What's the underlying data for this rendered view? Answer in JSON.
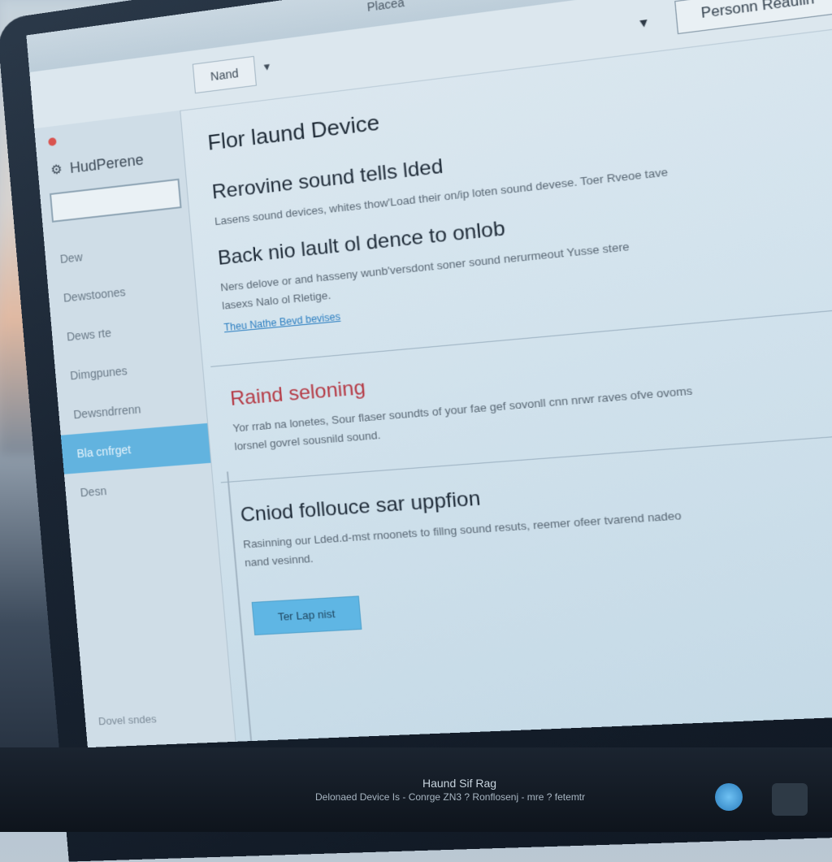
{
  "window": {
    "title": "Placea"
  },
  "toolbar": {
    "personal_button": "Personn Reaulin"
  },
  "tab": {
    "label": "Nand"
  },
  "sidebar": {
    "title": "HudPerene",
    "items": [
      {
        "label": "Dew"
      },
      {
        "label": "Dewstoones"
      },
      {
        "label": "Dews rte"
      },
      {
        "label": "Dimgpunes"
      },
      {
        "label": "Dewsndrrenn"
      },
      {
        "label": "Bla cnfrget"
      },
      {
        "label": "Desn"
      }
    ],
    "footer": "Dovel sndes"
  },
  "content": {
    "page_title": "Flor laund Device",
    "section1": {
      "heading": "Rerovine sound tells lded",
      "body": "Lasens sound devices, whites thow'Load their on/ip loten sound devese. Toer Rveoe tave"
    },
    "section2": {
      "heading": "Back nio lault ol dence to onlob",
      "body_line1": "Ners delove or and hasseny wunb'versdont soner sound nerurmeout Yusse stere",
      "body_line2": "lasexs Nalo ol Rletige.",
      "link": "Theu Nathe Bevd bevises"
    },
    "section3": {
      "heading": "Raind seloning",
      "body_line1": "Yor rrab na lonetes, Sour flaser soundts of your fae gef sovonll cnn nrwr raves ofve ovoms",
      "body_line2": "lorsnel govrel sousnild sound."
    },
    "section4": {
      "heading": "Cniod follouce sar uppfion",
      "body_line1": "Rasinning our Lded.d-mst rnoonets to fillng sound resuts, reemer ofeer tvarend nadeo",
      "body_line2": "nand vesinnd.",
      "button": "Ter Lap nist"
    }
  },
  "taskbar": {
    "title": "Haund Sif Rag",
    "status": "Delonaed Device Is - Conrge ZN3 ? Ronflosenj - mre ? fetemtr"
  }
}
